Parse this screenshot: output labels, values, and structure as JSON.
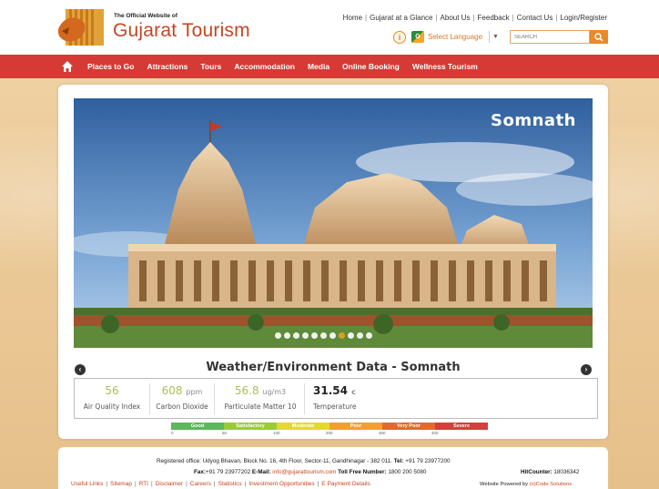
{
  "header": {
    "logo_small": "The Official Website of",
    "logo_big": "Gujarat Tourism",
    "top_links": [
      "Home",
      "Gujarat at a Glance",
      "About Us",
      "Feedback",
      "Contact Us",
      "Login/Register"
    ],
    "select_language": "Select Language",
    "search_placeholder": "SEARCH"
  },
  "nav": {
    "items": [
      "Places to Go",
      "Attractions",
      "Tours",
      "Accommodation",
      "Media",
      "Online Booking",
      "Wellness Tourism"
    ]
  },
  "hero": {
    "title": "Somnath",
    "slide_count": 11,
    "active_slide": 7
  },
  "weather": {
    "title": "Weather/Environment Data - Somnath",
    "metrics": [
      {
        "value": "56",
        "unit": "",
        "label": "Air Quality Index"
      },
      {
        "value": "608",
        "unit": "ppm",
        "label": "Carbon Dioxide"
      },
      {
        "value": "56.8",
        "unit": "ug/m3",
        "label": "Particulate Matter 10"
      },
      {
        "value": "31.54",
        "unit": "c",
        "label": "Temperature"
      }
    ],
    "scale": [
      {
        "label": "Good",
        "color": "#5cb85c"
      },
      {
        "label": "Satisfactory",
        "color": "#9acd32"
      },
      {
        "label": "Moderate",
        "color": "#e5d930"
      },
      {
        "label": "Poor",
        "color": "#f0a030"
      },
      {
        "label": "Very Poor",
        "color": "#e06a30"
      },
      {
        "label": "Severe",
        "color": "#d43f3a"
      }
    ],
    "ticks": [
      "0",
      "50",
      "100",
      "200",
      "300",
      "400"
    ]
  },
  "footer": {
    "address": "Registered office: Udyog Bhavan, Block No. 16, 4th Floor, Sector-11, Gandhinagar - 382 011.",
    "tel_label": "Tel:",
    "tel": "+91 79 23977200",
    "fax_label": "Fax:",
    "fax": "+91 79 23977202",
    "email_label": "E-Mail:",
    "email": "info@gujarattourism.com",
    "tollfree_label": "Toll Free Number:",
    "tollfree": "1800 200 5080",
    "hitcounter_label": "HitCounter:",
    "hitcounter": "18036342",
    "links": [
      "Useful Links",
      "Sitemap",
      "RTI",
      "Disclaimer",
      "Careers",
      "Statistics",
      "Investment Opportunities",
      "E Payment Details"
    ],
    "powered_label": "Website Powered by",
    "powered_by": "(n)Code Solutions"
  },
  "colors": {
    "nav_red": "#d63a34",
    "brand_orange": "#c7451f",
    "aqi_green": "#a8c256"
  }
}
